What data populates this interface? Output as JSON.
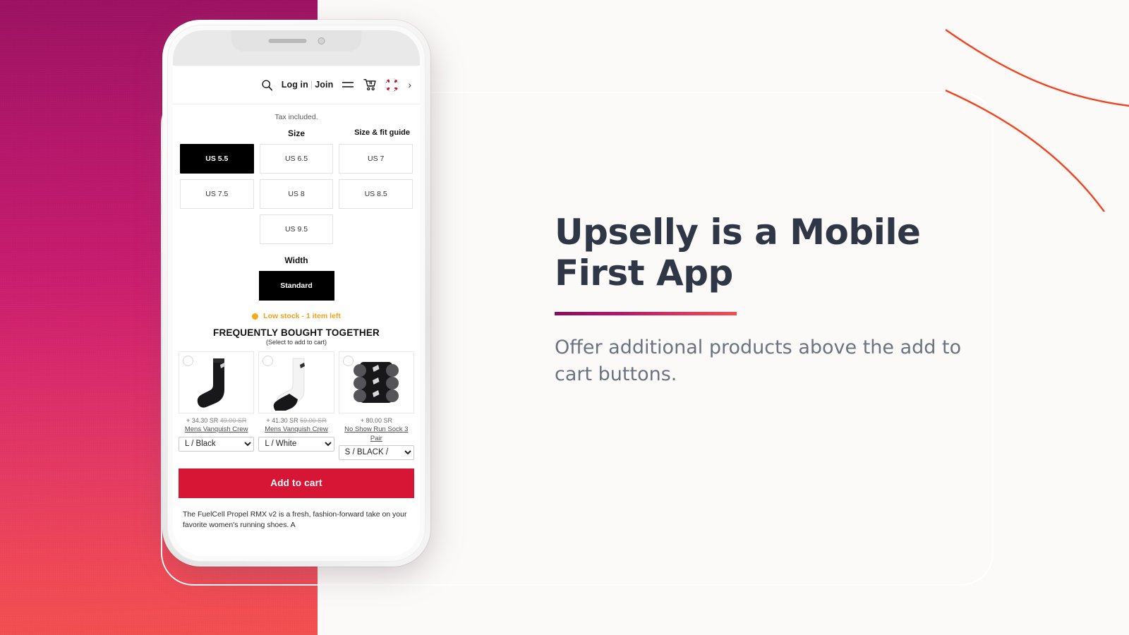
{
  "marketing": {
    "headline": "Upselly is a Mobile First App",
    "subtext": "Offer additional products above the add to cart buttons.",
    "accent_gradient_start": "#8a0c5c",
    "accent_gradient_end": "#f4504f",
    "headline_color": "#2f3646",
    "subtext_color": "#6b7280"
  },
  "background": {
    "left_panel_gradient_top": "#9c1263",
    "left_panel_gradient_bottom": "#f2504f",
    "page_bg": "#fbfaf8",
    "curve_color": "#f4441f"
  },
  "phone": {
    "app": {
      "header": {
        "search_icon": "search-icon",
        "login_label": "Log in",
        "separator": "|",
        "join_label": "Join",
        "menu_icon": "hamburger-menu-icon",
        "cart_icon": "shopping-cart-icon",
        "flag_icon": "uk-flag-icon",
        "chevron": "›"
      },
      "tax_note": "Tax included.",
      "size_section": {
        "title": "Size",
        "guide_link": "Size & fit guide",
        "options": [
          {
            "label": "US 5.5",
            "selected": true
          },
          {
            "label": "US 6.5",
            "selected": false
          },
          {
            "label": "US 7",
            "selected": false
          },
          {
            "label": "US 7.5",
            "selected": false
          },
          {
            "label": "US 8",
            "selected": false
          },
          {
            "label": "US 8.5",
            "selected": false
          },
          {
            "label": "US 9.5",
            "selected": false
          }
        ]
      },
      "width_section": {
        "title": "Width",
        "options": [
          {
            "label": "Standard",
            "selected": true
          }
        ]
      },
      "stock": {
        "dot_color": "#f7a81b",
        "text": "Low stock - 1 item left"
      },
      "frequently_bought": {
        "title": "FREQUENTLY BOUGHT TOGETHER",
        "subtitle": "(Select to add to cart)",
        "products": [
          {
            "image": "black-crew-sock-image",
            "price": "+ 34.30 SR",
            "compare_at": "49.00 SR",
            "name": "Mens Vanquish Crew",
            "variant": "L / Black"
          },
          {
            "image": "white-crew-sock-image",
            "price": "+ 41.30 SR",
            "compare_at": "59.00 SR",
            "name": "Mens Vanquish Crew",
            "variant": "L / White"
          },
          {
            "image": "no-show-sock-3pair-image",
            "price": "+ 80.00 SR",
            "compare_at": "",
            "name": "No Show Run Sock 3 Pair",
            "variant": "S / BLACK /"
          }
        ]
      },
      "add_to_cart": {
        "label": "Add to cart",
        "color": "#d71635"
      },
      "description": "The FuelCell Propel RMX v2 is a fresh, fashion-forward take on your favorite women's running shoes. A"
    }
  }
}
